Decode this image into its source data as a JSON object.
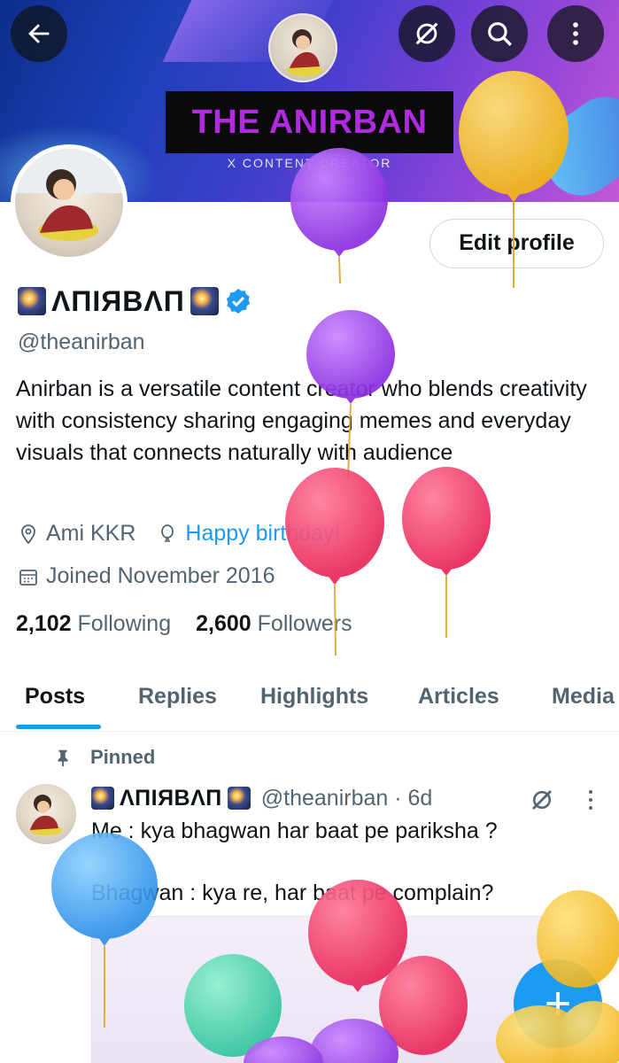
{
  "banner": {
    "title": "THE   ANIRBAN",
    "subtitle": "X CONTENT CREATOR"
  },
  "top_bar": {
    "back_icon": "arrow-left-icon",
    "grok_icon": "grok-slash-icon",
    "search_icon": "search-icon",
    "more_icon": "vertical-ellipsis-icon"
  },
  "profile": {
    "edit_label": "Edit profile",
    "display_name": "ΛПIЯBΛП",
    "handle": "@theanirban",
    "bio": "Anirban is a versatile content creator who blends creativity with consistency sharing engaging memes and everyday visuals that connects naturally with audience",
    "location": "Ami KKR",
    "birthday_link": "Happy birthday!",
    "joined": "Joined November 2016",
    "following_count": "2,102",
    "following_label": "Following",
    "followers_count": "2,600",
    "followers_label": "Followers"
  },
  "tabs": [
    "Posts",
    "Replies",
    "Highlights",
    "Articles",
    "Media"
  ],
  "post": {
    "pinned_label": "Pinned",
    "author_name": "ΛПIЯBΛП",
    "author_handle": "@theanirban · 6d",
    "line1": "Me : kya bhagwan har baat pe pariksha ?",
    "line2": "Bhagwan : kya re, har baat pe complain?"
  },
  "fab_label": "+",
  "colors": {
    "accent": "#1d9bf0",
    "title_text": "#b12ae0",
    "muted": "#536471"
  }
}
